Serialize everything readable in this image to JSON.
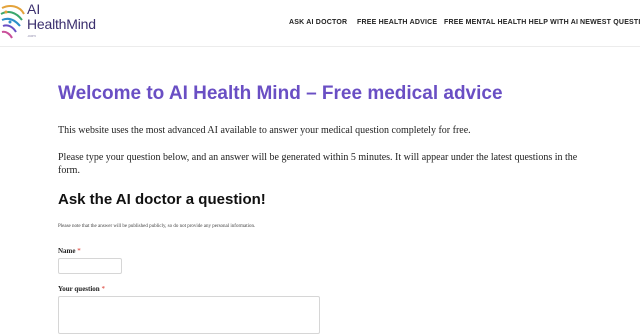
{
  "header": {
    "logo_line1": "AI",
    "logo_line2": "HealthMind",
    "logo_tagline": ".com",
    "nav": [
      {
        "label": "ASK AI DOCTOR"
      },
      {
        "label": "FREE HEALTH ADVICE"
      },
      {
        "label": "FREE MENTAL HEALTH HELP WITH AI"
      },
      {
        "label": "NEWEST QUESTIONS"
      }
    ]
  },
  "main": {
    "title": "Welcome to AI Health Mind – Free medical advice",
    "intro": "This website uses the most advanced AI available to answer your medical question completely for free.",
    "instructions": "Please type your question below, and an answer will be generated within 5 minutes. It will appear under the latest questions in the form.",
    "form_heading": "Ask the AI doctor a question!",
    "notice": "Please note that the answer will be published publicly, so do not provide any personal information.",
    "form": {
      "name_label": "Name",
      "name_value": "",
      "question_label": "Your question",
      "question_value": "",
      "required_mark": "*"
    }
  },
  "colors": {
    "accent": "#6a4fc4",
    "logo_text": "#3b2f6e",
    "required": "#d93025"
  }
}
